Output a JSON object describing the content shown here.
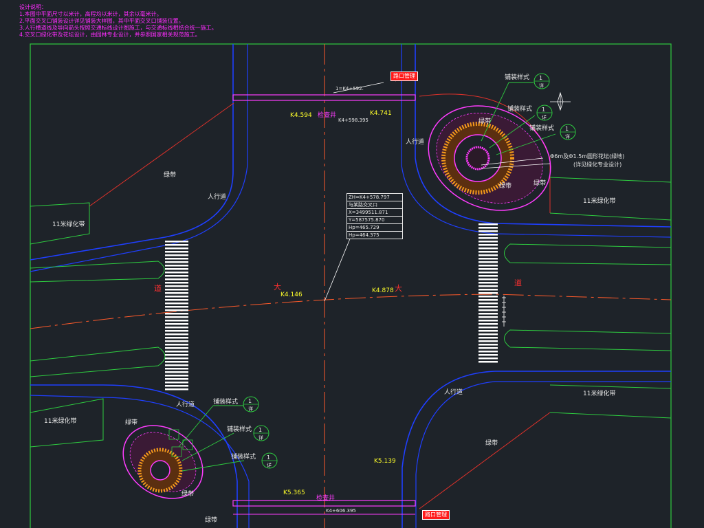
{
  "notes": {
    "title": "设计说明：",
    "lines": [
      "1.本图中平面尺寸以米计，高程均以米计，其余以毫米计。",
      "2.平面交叉口铺装设计详见铺装大样图，其中平面交叉口铺装位置。",
      "3.人行横道线及导向箭头按照交通标线设计图施工，与交通标线相结合统一施工。",
      "4.交叉口绿化带及花坛设计，由园林专业设计，并参照国家相关规范施工。"
    ]
  },
  "labels": {
    "green_belt": "绿带",
    "sidewalk": "人行道",
    "greening_belt": "11米绿化带",
    "inspection_well": "检查井",
    "paving_pattern": "铺装样式",
    "paving_mark": "1",
    "paving_sub": "详",
    "roundabout_note_1": "Φ6m及Φ1.5m圆形花坛(绿地)",
    "roundabout_note_2": "(详见绿化专业设计)",
    "road_name": "大",
    "road_name_left": "道",
    "road_name_right": "道"
  },
  "stations": {
    "top_left": "K4.594",
    "top_mid": "K4+598.395",
    "top_right": "K4.741",
    "left_mid": "K4.146",
    "center": "K4.878",
    "bottom": "K5.139",
    "bottom_left": "K5.365",
    "top_line": "1=K4+592.",
    "bottom_line": "K4+606.395"
  },
  "info_box": [
    "ZH=K4+578.797",
    "与某路交叉口",
    "X=3499511.871",
    "Y=587575.870",
    "Hp=465.729",
    "Hp=464.375"
  ],
  "tags": {
    "top": "路口管理",
    "bottom": "路口管理"
  },
  "colors": {
    "background": "#1e2329",
    "frame": "#2ecc40",
    "road_edge": "#1f3fff",
    "centerline": "#ff5a2a",
    "green_strip": "#2ecc40",
    "crosswalk": "#ffffff",
    "magenta": "#ff3cff",
    "orange_paving": "#f59a1c"
  }
}
